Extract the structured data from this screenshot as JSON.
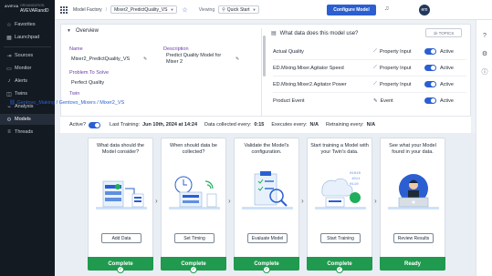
{
  "sidebar": {
    "logo": "AVEVA",
    "org_label": "ORGANIZATION",
    "org_name": "AVEVARandD",
    "items": [
      {
        "label": "Favorites",
        "icon": "star-icon"
      },
      {
        "label": "Launchpad",
        "icon": "launchpad-icon"
      },
      {
        "label": "Sources",
        "icon": "sources-icon"
      },
      {
        "label": "Monitor",
        "icon": "monitor-icon"
      },
      {
        "label": "Alerts",
        "icon": "bell-icon"
      },
      {
        "label": "Twins",
        "icon": "twins-icon"
      },
      {
        "label": "Analysis",
        "icon": "analysis-icon"
      },
      {
        "label": "Models",
        "icon": "models-icon"
      },
      {
        "label": "Threads",
        "icon": "threads-icon"
      }
    ]
  },
  "topbar": {
    "breadcrumb_root": "Model Factory",
    "breadcrumb_current": "Mixer2_PredictQuality_VS",
    "viewing_label": "Viewing",
    "viewing_value": "Quick Start",
    "configure_label": "Configure Model",
    "avatar_initials": "em"
  },
  "overview": {
    "title": "Overview",
    "name_label": "Name",
    "name_value": "Mixer2_PredictQuality_VS",
    "description_label": "Description",
    "description_value": "Predict Quality Model for Mixer 2",
    "problem_label": "Problem To Solve",
    "problem_value": "Perfect Quality",
    "twin_label": "Twin",
    "twin_value": "Gentovo_Making / Gentovo_Mixers / Mixer2_VS",
    "question": "What data does this model use?",
    "topics_label": "1k TOPICS",
    "rows": [
      {
        "name": "Actual Quality",
        "type": "Property Input",
        "state": "Active"
      },
      {
        "name": "ED.Mixing.Mixer.Agitator Speed",
        "type": "Property Input",
        "state": "Active"
      },
      {
        "name": "ED.Mixing.Mixer2.Agitator Power",
        "type": "Property Input",
        "state": "Active"
      },
      {
        "name": "Product Event",
        "type": "Event",
        "state": "Active"
      }
    ]
  },
  "status": {
    "active_label": "Active?",
    "last_training_label": "Last Training:",
    "last_training_value": "Jun 10th, 2024 at 14:24",
    "collected_label": "Data collected every:",
    "collected_value": "0:15",
    "executes_label": "Executes every:",
    "executes_value": "N/A",
    "retraining_label": "Retraining every:",
    "retraining_value": "N/A"
  },
  "steps": [
    {
      "title": "What data should the Model consider?",
      "button": "Add Data",
      "footer": "Complete"
    },
    {
      "title": "When should data be collected?",
      "button": "Set Timing",
      "footer": "Complete"
    },
    {
      "title": "Validate the Model's configuration.",
      "button": "Evaluate Model",
      "footer": "Complete"
    },
    {
      "title": "Start training a Model with your Twin's data.",
      "button": "Start Training",
      "footer": "Complete"
    },
    {
      "title": "See what your Model found in your data.",
      "button": "Review Results",
      "footer": "Ready"
    }
  ],
  "colors": {
    "accent": "#2b5fd1",
    "complete": "#1f9a4f",
    "sidebar": "#141a22"
  }
}
